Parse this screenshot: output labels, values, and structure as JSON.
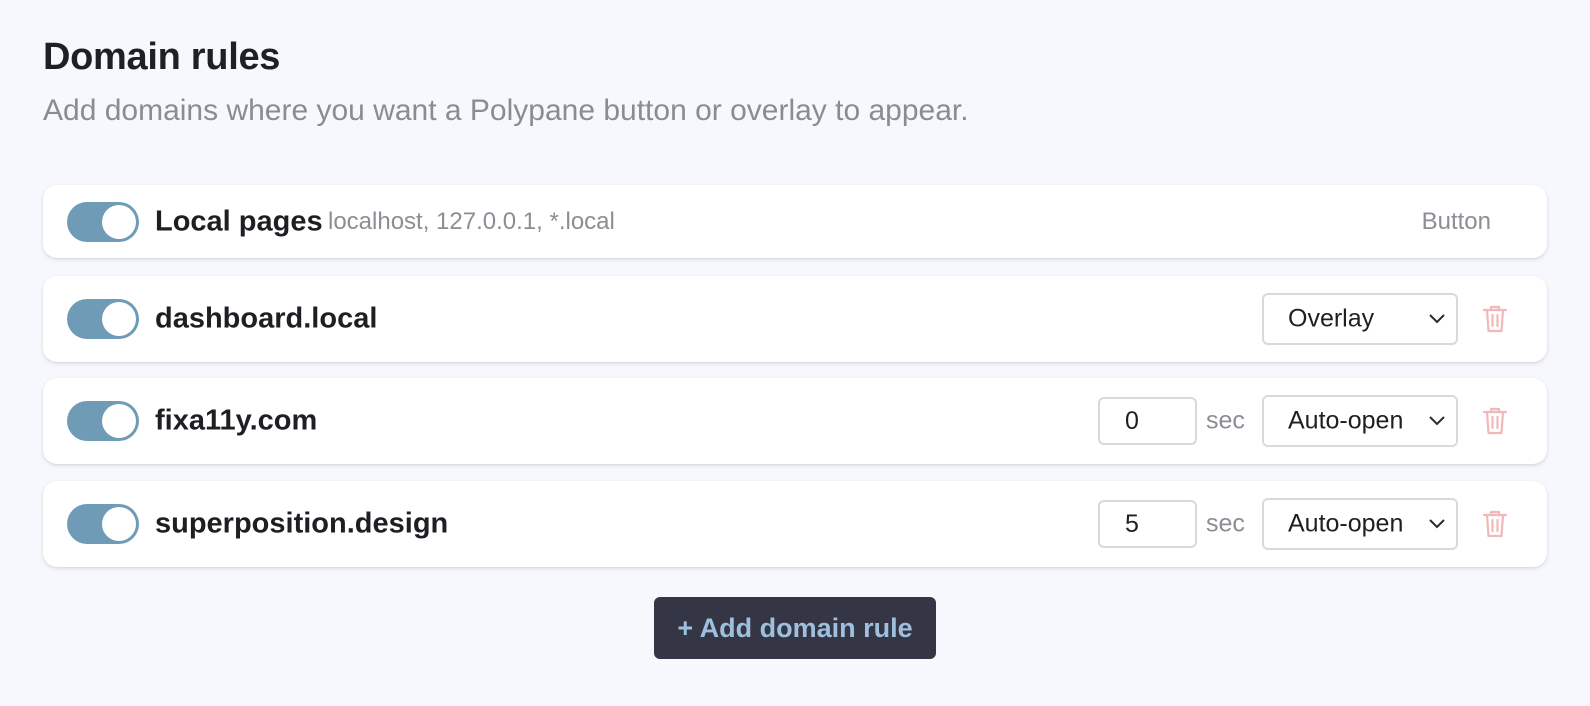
{
  "header": {
    "title": "Domain rules",
    "subtitle": "Add domains where you want a Polypane button or overlay to appear."
  },
  "rules": [
    {
      "enabled": true,
      "name": "Local pages",
      "hosts": "localhost, 127.0.0.1, *.local",
      "mode": "Button"
    },
    {
      "enabled": true,
      "name": "dashboard.local",
      "mode": "Overlay"
    },
    {
      "enabled": true,
      "name": "fixa11y.com",
      "delay": "0",
      "delay_unit": "sec",
      "mode": "Auto-open"
    },
    {
      "enabled": true,
      "name": "superposition.design",
      "delay": "5",
      "delay_unit": "sec",
      "mode": "Auto-open"
    }
  ],
  "add_button": {
    "label": "+ Add domain rule"
  },
  "icons": {
    "toggle": "toggle-switch",
    "select": "chevron-down-icon",
    "delete": "trash-icon"
  },
  "colors": {
    "toggle_on": "#6f9bb7",
    "button_bg": "#343545",
    "button_text": "#9fc0dd",
    "trash": "#f2b8b8"
  }
}
